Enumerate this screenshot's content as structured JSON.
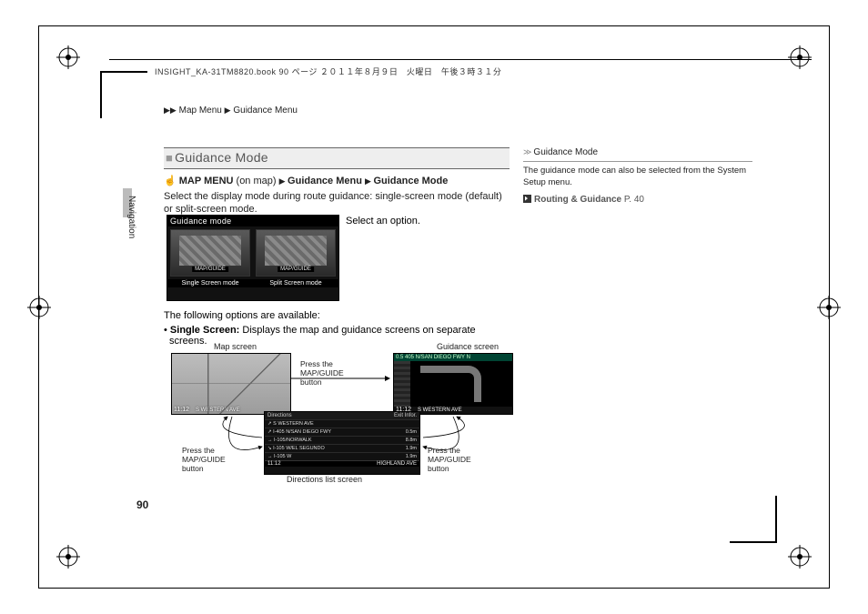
{
  "meta": {
    "header_text": "INSIGHT_KA-31TM8820.book  90 ページ  ２０１１年８月９日　火曜日　午後３時３１分"
  },
  "breadcrumb": {
    "a": "Map Menu",
    "b": "Guidance Menu"
  },
  "side_tab_label": "Navigation",
  "section": {
    "title": "Guidance Mode",
    "path_prefix": "MAP MENU",
    "path_note": "(on map)",
    "path_a": "Guidance Menu",
    "path_b": "Guidance Mode",
    "intro": "Select the display mode during route guidance: single-screen mode (default) or split-screen mode.",
    "select_option": "Select an option.",
    "hero_title": "Guidance mode",
    "hero_badge": "MAP/GUIDE",
    "hero_cap_a": "Single Screen mode",
    "hero_cap_b": "Split Screen mode",
    "below_line": "The following options are available:",
    "bullet_label": "Single Screen:",
    "bullet_rest": " Displays the map and guidance screens on separate screens."
  },
  "diagram": {
    "cap_map": "Map screen",
    "cap_guide": "Guidance screen",
    "cap_dir": "Directions list screen",
    "press_button": "Press the MAP/GUIDE button",
    "guide_top": "0.5  405 N/SAN DIEGO FWY N",
    "time_a": "11:12",
    "time_b": "11:12",
    "time_c": "11:12",
    "street": "S WESTERN AVE",
    "dir_top_left": "Directions",
    "dir_top_right": "Exit Infor.",
    "dir_rows": [
      {
        "l": "↗  S WESTERN AVE",
        "r": ""
      },
      {
        "l": "↗  I-405 N/SAN DIEGO FWY",
        "r": "0.5m"
      },
      {
        "l": "→  I-105/NORWALK",
        "r": "8.8m"
      },
      {
        "l": "↘  I-105 W/EL SEGUNDO",
        "r": "1.9m"
      },
      {
        "l": "→  I-105 W",
        "r": "1.9m"
      }
    ],
    "dir_btm_left": "11:12",
    "dir_btm_right": "HIGHLAND AVE"
  },
  "sidebar": {
    "head_title": "Guidance Mode",
    "body": "The guidance mode can also be selected from the System Setup menu.",
    "link_label": "Routing & Guidance",
    "link_page": "P. 40"
  },
  "page_number": "90"
}
